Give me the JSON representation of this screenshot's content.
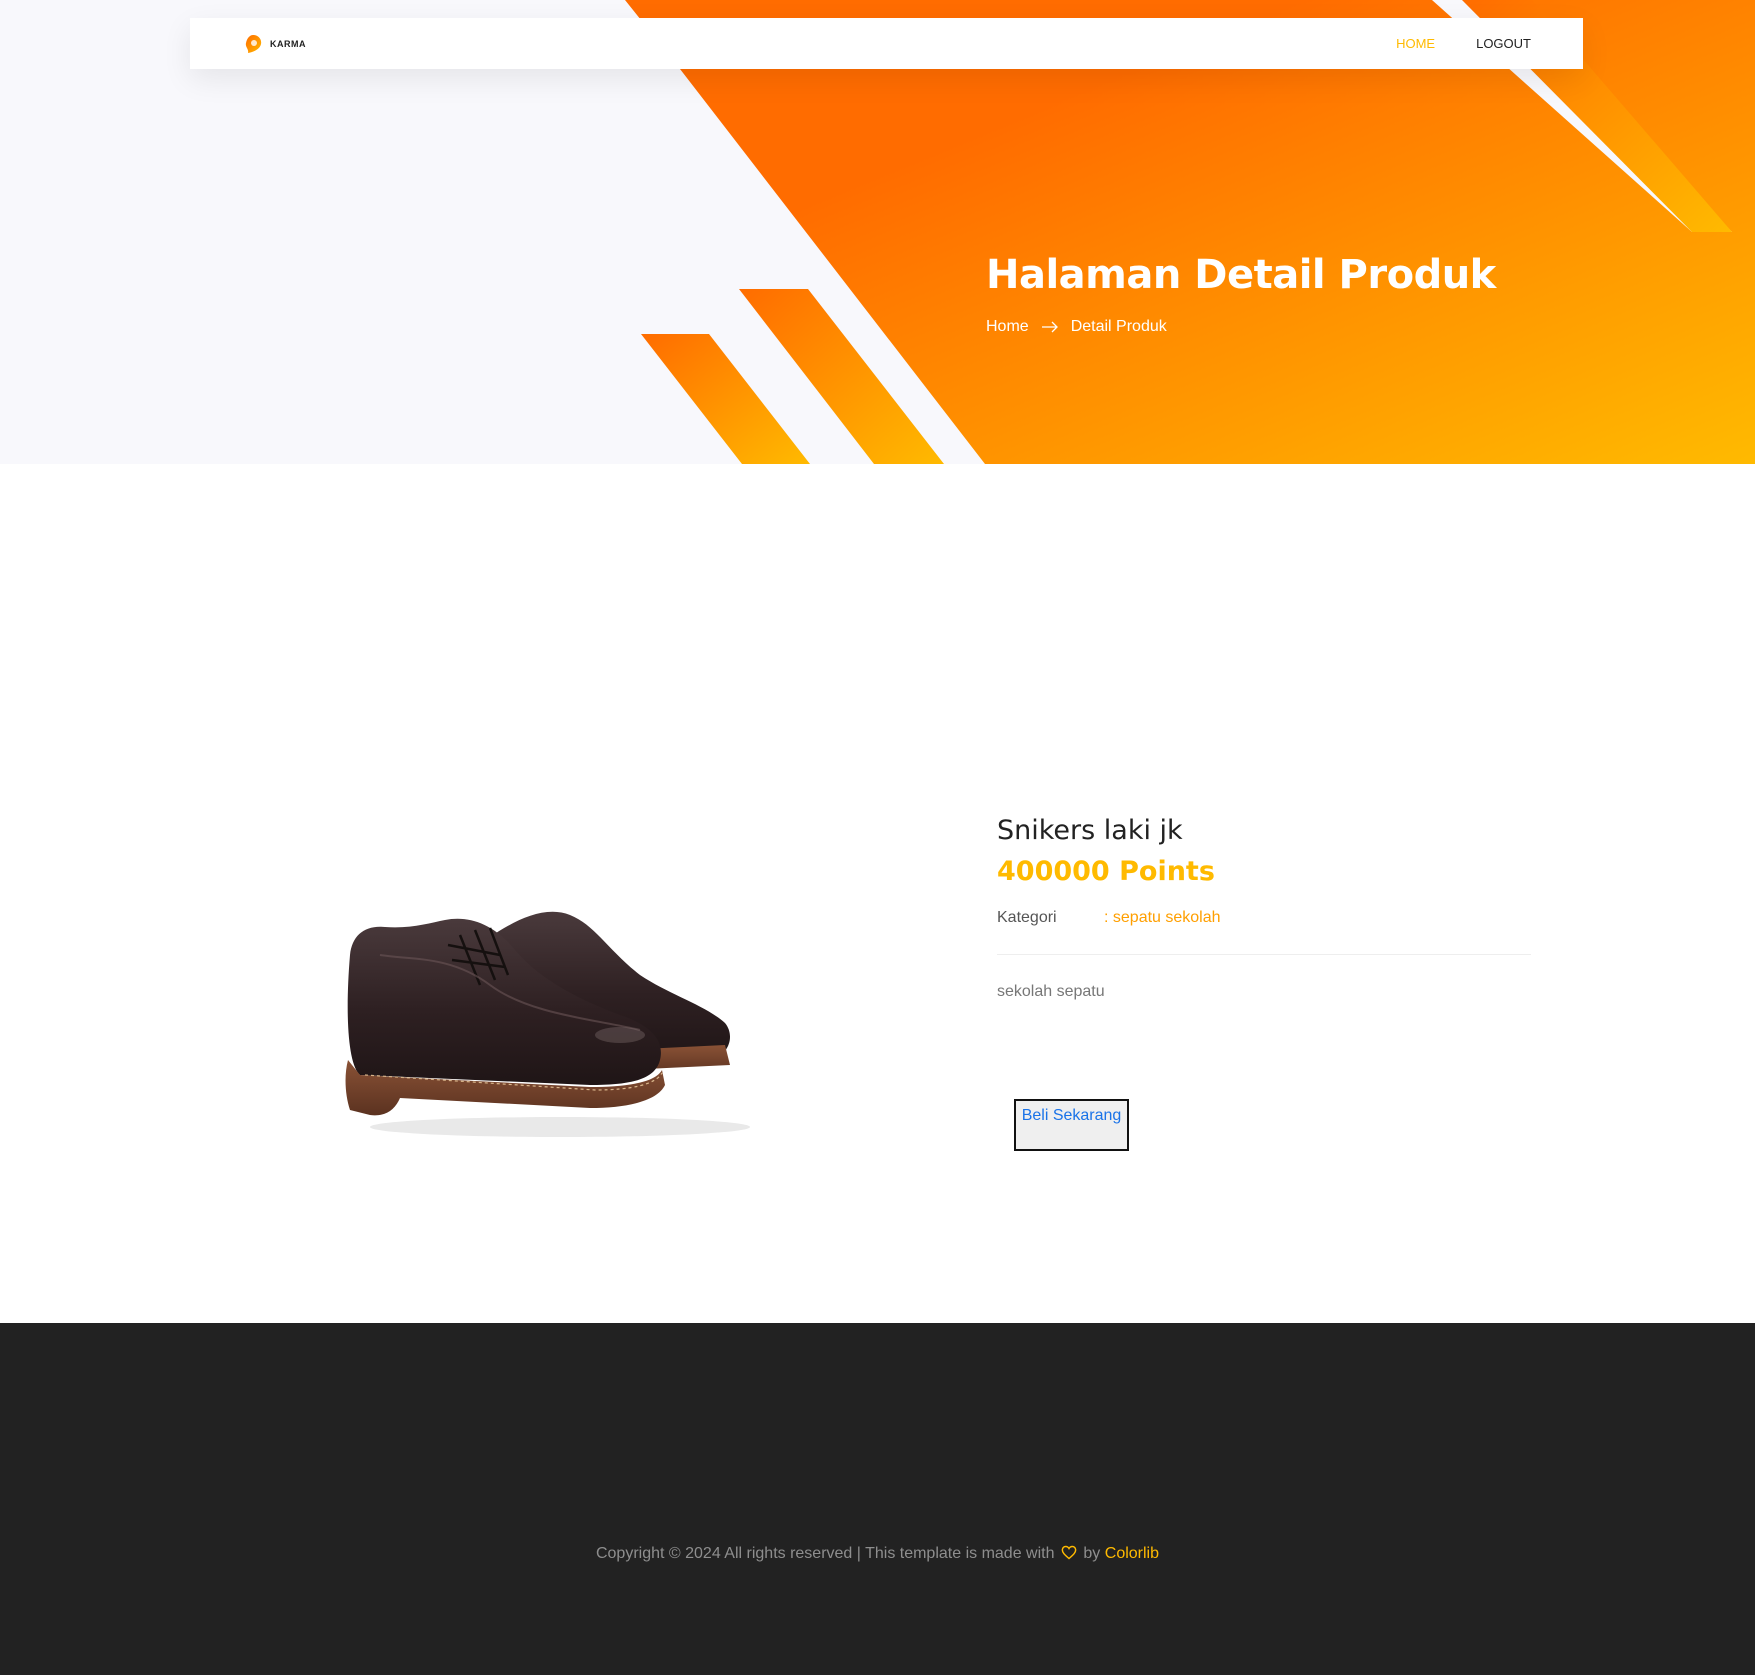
{
  "header": {
    "logo_text": "KARMA",
    "nav": [
      {
        "label": "HOME",
        "active": true
      },
      {
        "label": "LOGOUT",
        "active": false
      }
    ]
  },
  "banner": {
    "title": "Halaman Detail Produk",
    "breadcrumb": {
      "home": "Home",
      "separator_icon": "arrow-right-icon",
      "current": "Detail Produk"
    }
  },
  "product": {
    "name": "Snikers laki jk",
    "price": "400000 Points",
    "category_label": "Kategori",
    "category_value": ": sepatu sekolah",
    "description": "sekolah sepatu",
    "buy_button": "Beli Sekarang",
    "image_icon": "leather-shoes-image"
  },
  "footer": {
    "copyright_prefix": "Copyright © 2024 All rights reserved | This template is made with",
    "heart_icon": "heart-icon",
    "by": "by",
    "brand_link": "Colorlib"
  },
  "colors": {
    "accent": "#ffba00",
    "orange": "#ff6c00",
    "footer_bg": "#222222"
  }
}
